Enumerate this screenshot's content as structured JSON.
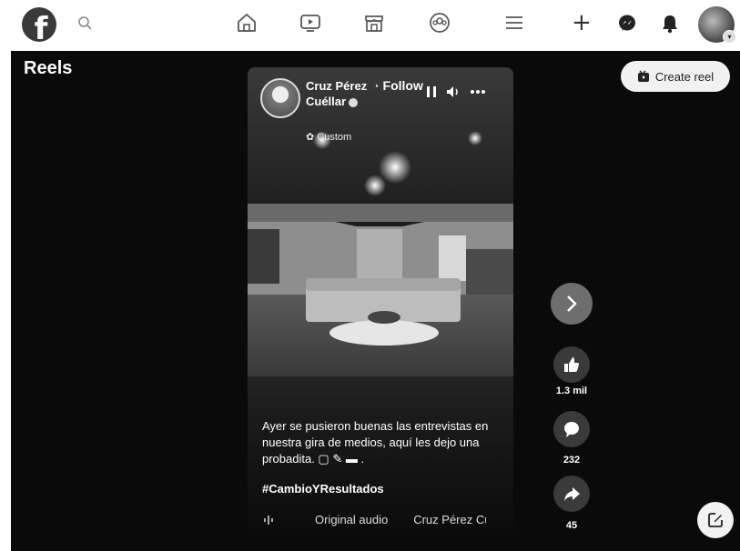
{
  "header": {
    "logo_letter": "f",
    "nav_icons": [
      "home-icon",
      "video-icon",
      "marketplace-icon",
      "groups-icon",
      "menu-icon"
    ],
    "right_icons": [
      "plus-icon",
      "messenger-icon",
      "notifications-icon",
      "account-avatar"
    ]
  },
  "page": {
    "title": "Reels",
    "create_reel_label": "Create reel"
  },
  "reel": {
    "author_name": "Cruz Pérez Cuéllar",
    "follow_label": "· Follow",
    "privacy_label": "✿ Custom",
    "caption": "Ayer se pusieron buenas las entrevistas en nuestra gira de medios, aquí les dejo una probadita. ▢ ✎ ▬ .",
    "hashtag": "#CambioYResultados",
    "audio_label": "Original audio",
    "audio_author": "Cruz Pérez Cuéllar"
  },
  "actions": {
    "likes": "1.3 mil",
    "comments": "232",
    "shares": "45"
  },
  "colors": {
    "background": "#0a0a0a",
    "topbar": "#ffffff",
    "button_dark": "#3a3a3a"
  }
}
